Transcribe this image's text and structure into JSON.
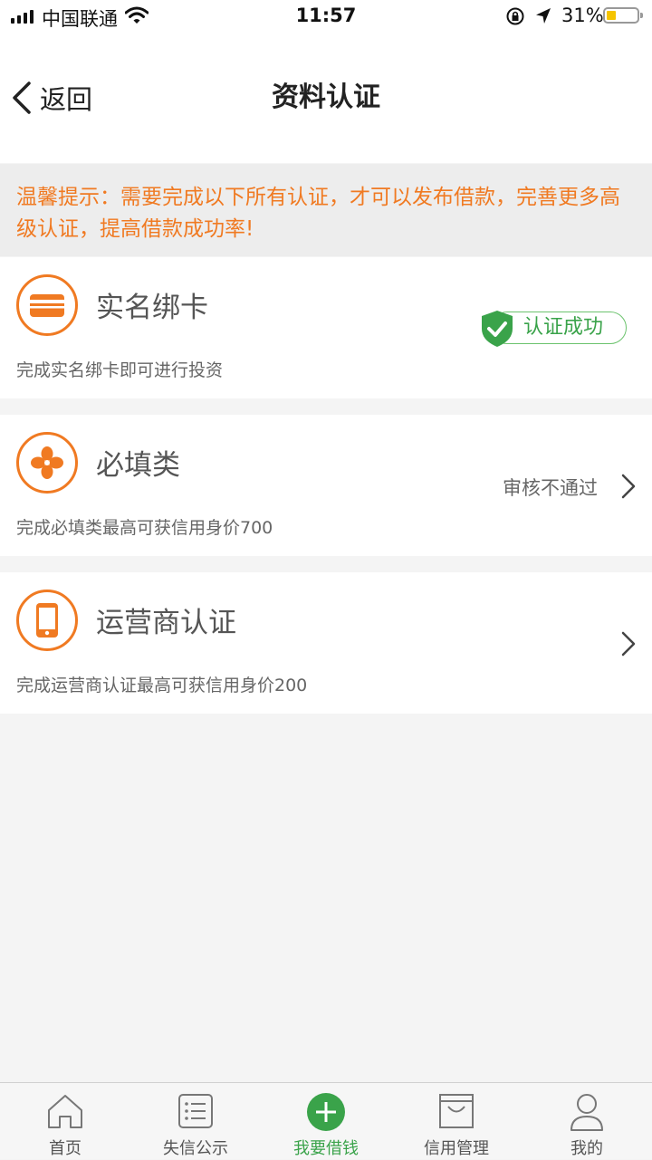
{
  "status_bar": {
    "carrier": "中国联通",
    "time": "11:57",
    "battery": "31%",
    "battery_level": 0.31
  },
  "nav": {
    "back_label": "返回",
    "title": "资料认证"
  },
  "tip": "温馨提示：需要完成以下所有认证，才可以发布借款，完善更多高级认证，提高借款成功率!",
  "cards": [
    {
      "title": "实名绑卡",
      "desc": "完成实名绑卡即可进行投资",
      "status": "认证成功",
      "icon": "card-icon"
    },
    {
      "title": "必填类",
      "desc": "完成必填类最高可获信用身价700",
      "status": "审核不通过",
      "icon": "clover-icon"
    },
    {
      "title": "运营商认证",
      "desc": "完成运营商认证最高可获信用身价200",
      "status": "",
      "icon": "phone-icon"
    }
  ],
  "tabs": [
    {
      "label": "首页",
      "icon": "home-icon"
    },
    {
      "label": "失信公示",
      "icon": "list-icon"
    },
    {
      "label": "我要借钱",
      "icon": "plus-circle-icon"
    },
    {
      "label": "信用管理",
      "icon": "bag-icon"
    },
    {
      "label": "我的",
      "icon": "user-icon"
    }
  ],
  "colors": {
    "accent": "#f07a22",
    "success": "#3aa34a",
    "background": "#f4f4f4"
  }
}
